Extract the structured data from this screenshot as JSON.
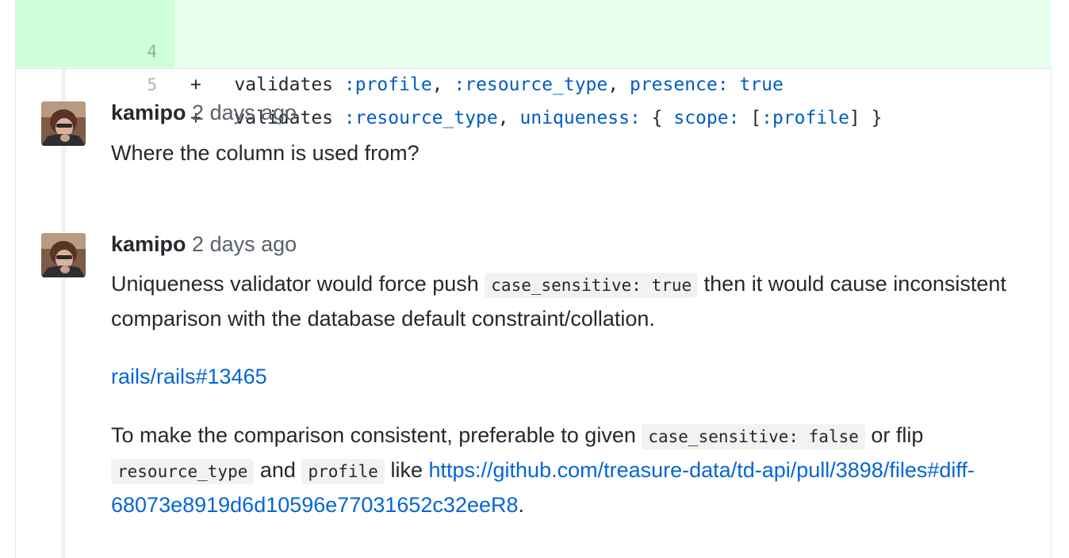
{
  "diff": {
    "lines": [
      {
        "num": "4",
        "marker": "+",
        "t1": "validates ",
        "t2": ":profile",
        "t3": ", ",
        "t4": ":resource_type",
        "t5": ", ",
        "t6": "presence:",
        "t7": " ",
        "t8": "true",
        "t9": ""
      },
      {
        "num": "5",
        "marker": "+",
        "t1": "validates ",
        "t2": ":resource_type",
        "t3": ", ",
        "t4": "uniqueness:",
        "t5": " { ",
        "t6": "scope:",
        "t7": " [",
        "t8": ":profile",
        "t9": "] }"
      }
    ]
  },
  "comments": [
    {
      "author": "kamipo",
      "time": "2 days ago",
      "text": "Where the column is used from?"
    },
    {
      "author": "kamipo",
      "time": "2 days ago",
      "p1_a": "Uniqueness validator would force push ",
      "p1_code": "case_sensitive: true",
      "p1_b": " then it would cause inconsistent comparison with the database default constraint/collation.",
      "link1": "rails/rails#13465",
      "p3_a": "To make the comparison consistent, preferable to given ",
      "p3_code1": "case_sensitive: false",
      "p3_b": " or flip ",
      "p3_code2": "resource_type",
      "p3_c": " and ",
      "p3_code3": "profile",
      "p3_d": " like ",
      "p3_link": "https://github.com/treasure-data/td-api/pull/3898/files#diff-68073e8919d6d10596e77031652c32eeR8",
      "p3_e": "."
    }
  ],
  "colors": {
    "diff_bg": "#e6ffed",
    "gutter_bg": "#cdffd8",
    "link": "#0366d6",
    "keyword": "#005cc5"
  },
  "icons": {
    "avatar": "user-avatar"
  }
}
